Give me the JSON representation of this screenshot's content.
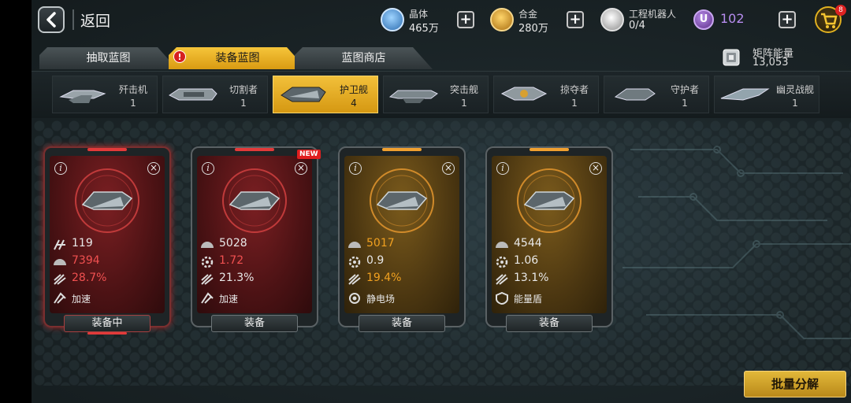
{
  "header": {
    "back_label": "返回",
    "resources": [
      {
        "name": "晶体",
        "value": "465万",
        "icon": "crystal-icon",
        "color": "#5aa9e6"
      },
      {
        "name": "合金",
        "value": "280万",
        "icon": "alloy-icon",
        "color": "#e0a020"
      },
      {
        "name": "工程机器人",
        "value": "0/4",
        "icon": "robot-icon",
        "color": "#d8d8d8"
      }
    ],
    "u_currency": {
      "value": "102",
      "icon": "u-coin-icon",
      "color": "#b78df0"
    },
    "plus_label": "+",
    "cart_badge": "8"
  },
  "tabs": [
    {
      "label": "抽取蓝图",
      "active": false
    },
    {
      "label": "装备蓝图",
      "active": true,
      "alert": "!"
    },
    {
      "label": "蓝图商店",
      "active": false
    }
  ],
  "matrix_energy": {
    "label": "矩阵能量",
    "value": "13,053"
  },
  "ship_types": [
    {
      "name": "歼击机",
      "count": "1",
      "active": false
    },
    {
      "name": "切割者",
      "count": "1",
      "active": false
    },
    {
      "name": "护卫舰",
      "count": "4",
      "active": true
    },
    {
      "name": "突击舰",
      "count": "1",
      "active": false
    },
    {
      "name": "掠夺者",
      "count": "1",
      "active": false
    },
    {
      "name": "守护者",
      "count": "1",
      "active": false
    },
    {
      "name": "幽灵战舰",
      "count": "1",
      "active": false
    }
  ],
  "cards": [
    {
      "rarity": "red",
      "equipped": true,
      "new": false,
      "stats": [
        "119",
        "7394",
        "28.7%",
        "加速"
      ],
      "stat_colors": [
        "white",
        "red",
        "red",
        "white"
      ],
      "button": "装备中"
    },
    {
      "rarity": "red",
      "equipped": false,
      "new": true,
      "new_label": "NEW",
      "stats": [
        "5028",
        "1.72",
        "21.3%",
        "加速"
      ],
      "stat_colors": [
        "white",
        "red",
        "white",
        "white"
      ],
      "button": "装备"
    },
    {
      "rarity": "gold",
      "equipped": false,
      "new": false,
      "stats": [
        "5017",
        "0.9",
        "19.4%",
        "静电场"
      ],
      "stat_colors": [
        "gold",
        "white",
        "gold",
        "white"
      ],
      "button": "装备"
    },
    {
      "rarity": "gold",
      "equipped": false,
      "new": false,
      "stats": [
        "4544",
        "1.06",
        "13.1%",
        "能量盾"
      ],
      "stat_colors": [
        "white",
        "white",
        "white",
        "white"
      ],
      "button": "装备"
    }
  ],
  "bulk_button": "批量分解",
  "colors": {
    "accent": "#e8b430",
    "red_rarity": "#7a1f22",
    "gold_rarity": "#7a5a1c"
  }
}
